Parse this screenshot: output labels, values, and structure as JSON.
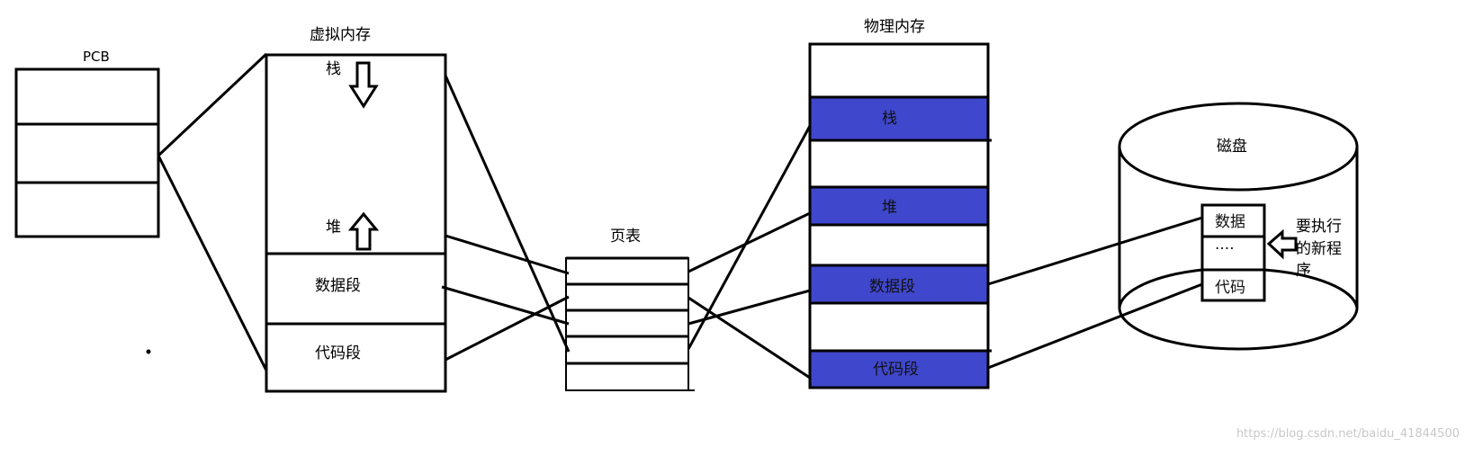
{
  "colors": {
    "highlight": "#3f47cc",
    "line": "#000000",
    "background": "#ffffff",
    "watermark": "#c8c8c8"
  },
  "pcb": {
    "title": "PCB"
  },
  "virtual_memory": {
    "title": "虚拟内存",
    "stack": "栈",
    "heap": "堆",
    "data_segment": "数据段",
    "code_segment": "代码段"
  },
  "page_table": {
    "title": "页表"
  },
  "physical_memory": {
    "title": "物理内存",
    "stack": "栈",
    "heap": "堆",
    "data_segment": "数据段",
    "code_segment": "代码段"
  },
  "disk": {
    "title": "磁盘",
    "data": "数据",
    "ellipsis": "····",
    "code": "代码",
    "new_program_note_line1": "要执行",
    "new_program_note_line2": "的新程",
    "new_program_note_line3": "序"
  },
  "watermark": "https://blog.csdn.net/baidu_41844500"
}
